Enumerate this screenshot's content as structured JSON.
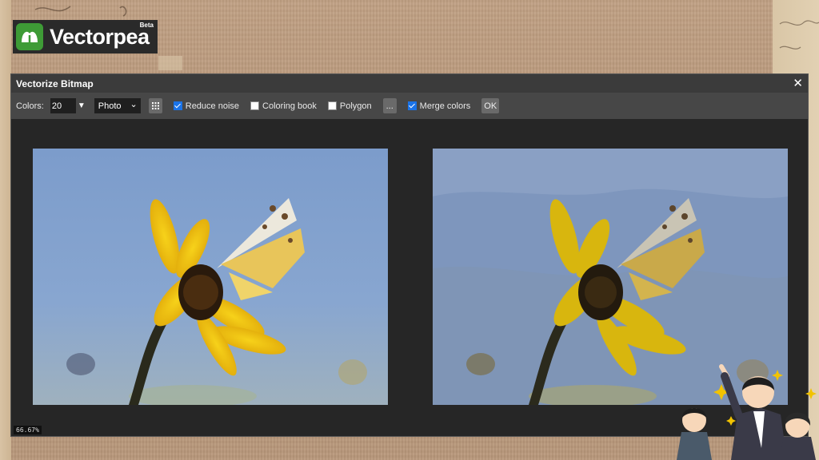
{
  "brand": {
    "name": "Vectorpea",
    "badge": "Beta"
  },
  "dialog": {
    "title": "Vectorize Bitmap",
    "close_glyph": "✕",
    "toolbar": {
      "colors_label": "Colors:",
      "colors_value": "20",
      "colors_arrow": "▼",
      "mode_selected": "Photo",
      "mode_chevron": "⌄",
      "options": [
        {
          "label": "Reduce noise",
          "checked": true
        },
        {
          "label": "Coloring book",
          "checked": false
        },
        {
          "label": "Polygon",
          "checked": false
        }
      ],
      "more_label": "...",
      "merge_label": "Merge colors",
      "merge_checked": true,
      "ok_label": "OK"
    },
    "zoom": "66.67%"
  },
  "colors": {
    "accent": "#3e9b36",
    "checkbox": "#1a73e8",
    "dialog_bg": "#262626",
    "toolbar_bg": "#474747"
  },
  "icons": [
    "logo-icon",
    "grid-icon",
    "close-icon",
    "checkbox-icon"
  ]
}
